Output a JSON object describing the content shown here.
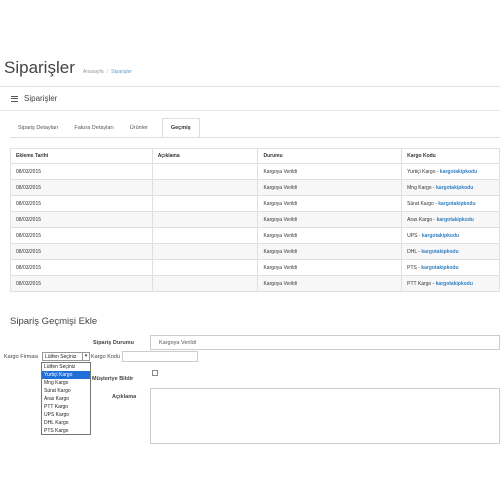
{
  "header": {
    "title": "Siparişler",
    "breadcrumb_home": "Anasayfa",
    "breadcrumb_sep": "/",
    "breadcrumb_current": "Siparişler"
  },
  "panel": {
    "title": "Siparişler",
    "tabs": [
      {
        "label": "Sipariş Detayları",
        "active": false
      },
      {
        "label": "Fatura Detayları",
        "active": false
      },
      {
        "label": "Ürünler",
        "active": false
      },
      {
        "label": "Geçmiş",
        "active": true
      }
    ]
  },
  "history": {
    "columns": [
      "Ekleme Tarihi",
      "Açıklama",
      "Durumu",
      "Kargo Kodu"
    ],
    "rows": [
      {
        "date": "08/03/2015",
        "desc": "",
        "status": "Kargoya Verildi",
        "cargo": "Yurtiçi Kargo - ",
        "code": "kargotakipkodu"
      },
      {
        "date": "08/03/2015",
        "desc": "",
        "status": "Kargoya Verildi",
        "cargo": "Mng Kargo - ",
        "code": "kargotakipkodu"
      },
      {
        "date": "08/03/2015",
        "desc": "",
        "status": "Kargoya Verildi",
        "cargo": "Sürat Kargo - ",
        "code": "kargotakipkodu"
      },
      {
        "date": "08/03/2015",
        "desc": "",
        "status": "Kargoya Verildi",
        "cargo": "Aras Kargo - ",
        "code": "kargotakipkodu"
      },
      {
        "date": "08/03/2015",
        "desc": "",
        "status": "Kargoya Verildi",
        "cargo": "UPS - ",
        "code": "kargotakipkodu"
      },
      {
        "date": "08/03/2015",
        "desc": "",
        "status": "Kargoya Verildi",
        "cargo": "DHL - ",
        "code": "kargotakipkodu"
      },
      {
        "date": "08/03/2015",
        "desc": "",
        "status": "Kargoya Verildi",
        "cargo": "PTS - ",
        "code": "kargotakipkodu"
      },
      {
        "date": "08/03/2015",
        "desc": "",
        "status": "Kargoya Verildi",
        "cargo": "PTT Kargo - ",
        "code": "kargotakipkodu"
      }
    ]
  },
  "form": {
    "section_title": "Sipariş Geçmişi Ekle",
    "status_label": "Sipariş Durumu",
    "status_value": "Kargoya Verildi",
    "company_label": "Kargo Firması",
    "company_value": "Lütfen Seçiniz",
    "code_label": "Kargo Kodu",
    "code_value": "",
    "notify_label": "Müşteriye Bildir",
    "notify_checked": false,
    "desc_label": "Açıklama",
    "desc_value": "",
    "company_options": [
      {
        "label": "Lütfen Seçiniz",
        "highlighted": false
      },
      {
        "label": "Yurtiçi Kargo",
        "highlighted": true
      },
      {
        "label": "Mng Kargo",
        "highlighted": false
      },
      {
        "label": "Sürat Kargo",
        "highlighted": false
      },
      {
        "label": "Aras Kargo",
        "highlighted": false
      },
      {
        "label": "PTT Kargo",
        "highlighted": false
      },
      {
        "label": "UPS Kargo",
        "highlighted": false
      },
      {
        "label": "DHL Kargo",
        "highlighted": false
      },
      {
        "label": "PTS Kargo",
        "highlighted": false
      }
    ]
  },
  "colors": {
    "link": "#2f7fc1",
    "breadcrumb_current": "#5a9fd4",
    "option_highlight": "#1e70d6"
  },
  "icons": {
    "panel_icon": "list-icon",
    "select_arrow": "chevron-down-icon"
  }
}
